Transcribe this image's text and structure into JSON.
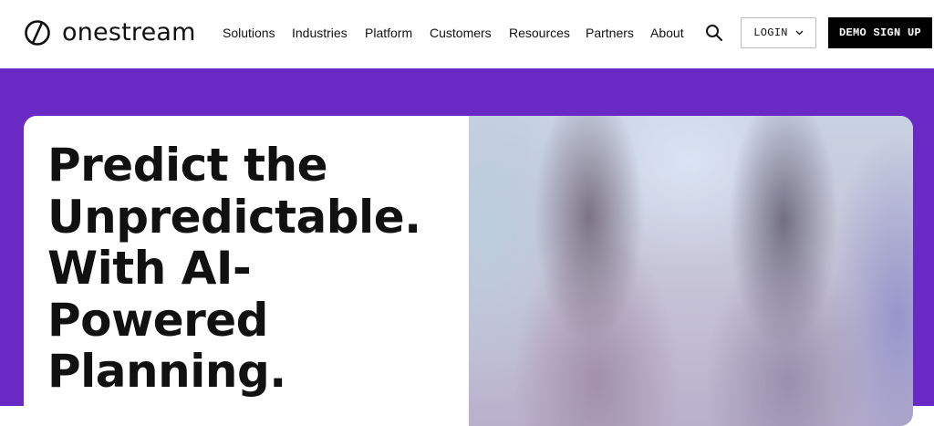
{
  "brand": {
    "name": "onestream"
  },
  "nav": {
    "items": [
      {
        "id": "solutions",
        "label": "Solutions"
      },
      {
        "id": "industries",
        "label": "Industries"
      },
      {
        "id": "platform",
        "label": "Platform"
      },
      {
        "id": "customers",
        "label": "Customers"
      },
      {
        "id": "resources",
        "label": "Resources"
      },
      {
        "id": "partners",
        "label": "Partners"
      },
      {
        "id": "about",
        "label": "About"
      }
    ],
    "search_icon": "search-icon",
    "login_label": "LOGIN",
    "login_icon": "chevron-down-icon",
    "demo_label": "DEMO SIGN UP"
  },
  "hero": {
    "headline_lines": [
      "Predict the",
      "Unpredictable.",
      "With AI-",
      "Powered",
      "Planning."
    ],
    "image": "blurred-hero-photo"
  },
  "colors": {
    "hero_background": "#6a28c4",
    "demo_button_bg": "#000000",
    "text": "#111111"
  }
}
